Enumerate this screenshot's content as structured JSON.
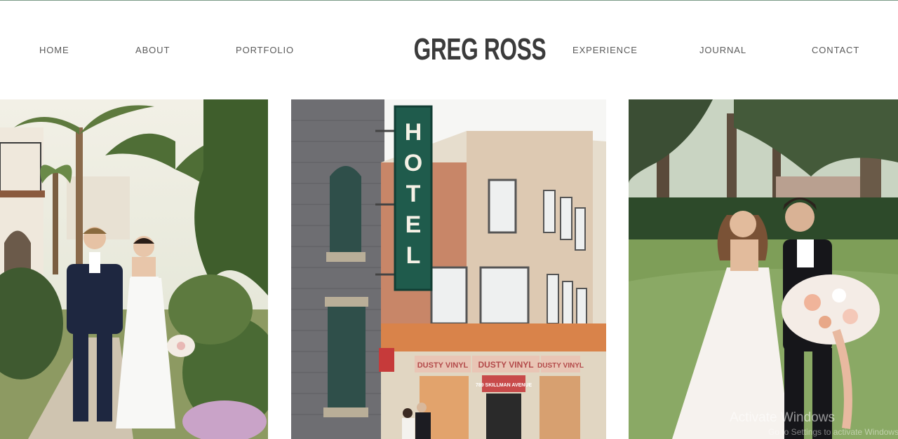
{
  "nav": {
    "left": [
      {
        "label": "HOME"
      },
      {
        "label": "ABOUT"
      },
      {
        "label": "PORTFOLIO"
      }
    ],
    "right": [
      {
        "label": "EXPERIENCE"
      },
      {
        "label": "JOURNAL"
      },
      {
        "label": "CONTACT"
      }
    ]
  },
  "logo": "GREG ROSS",
  "gallery": {
    "photo1": {
      "subject": "wedding couple walking on garden path among palm trees"
    },
    "photo2": {
      "subject": "couple in front of brick hotel building",
      "sign_text": "HOTEL",
      "storefront": "DUSTY VINYL",
      "door_sign": "789 SKILLMAN AVENUE"
    },
    "photo3": {
      "subject": "bride and groom walking through grassy field with bouquet"
    }
  },
  "os_watermark": {
    "line1": "Activate Windows",
    "line2": "Go to Settings to activate Windows."
  },
  "colors": {
    "background": "#ffffff",
    "nav_text": "#5a5a5a",
    "logo_text": "#3b3b3b",
    "hotel_sign": "#1f5b4c"
  }
}
